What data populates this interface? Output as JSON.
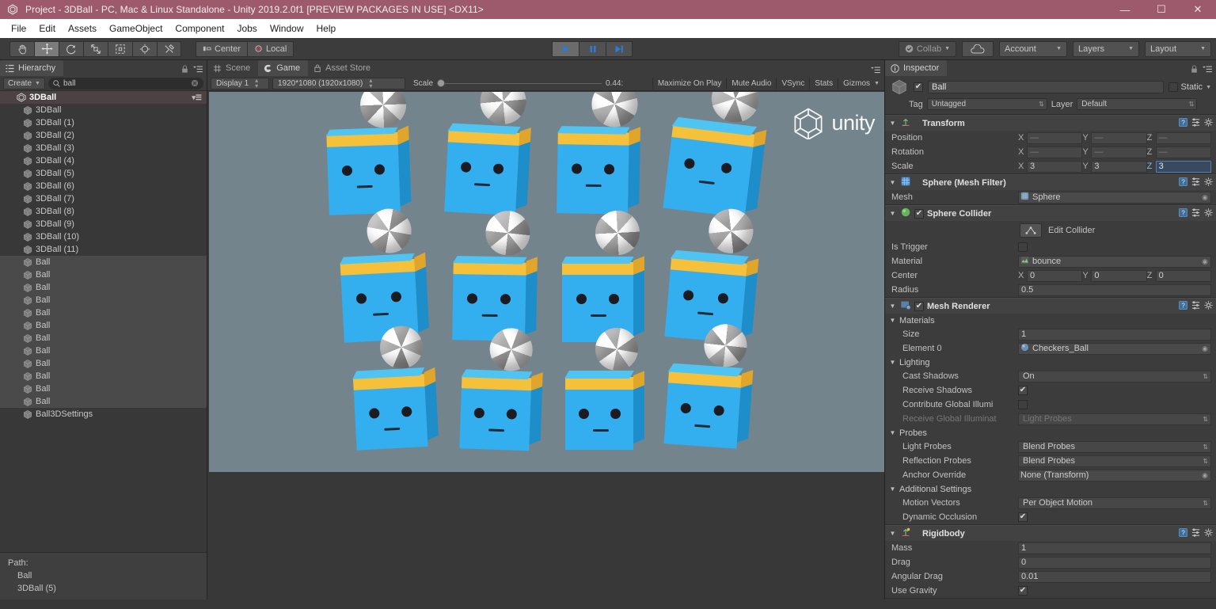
{
  "window": {
    "title": "Project - 3DBall - PC, Mac & Linux Standalone - Unity 2019.2.0f1 [PREVIEW PACKAGES IN USE] <DX11>",
    "minimize": "—",
    "maximize": "☐",
    "close": "✕",
    "titlebar_color": "#9c5a6c"
  },
  "menubar": {
    "items": [
      "File",
      "Edit",
      "Assets",
      "GameObject",
      "Component",
      "Jobs",
      "Window",
      "Help"
    ]
  },
  "toolbar": {
    "tools": [
      {
        "name": "hand-tool",
        "active": false
      },
      {
        "name": "move-tool",
        "active": true
      },
      {
        "name": "rotate-tool",
        "active": false
      },
      {
        "name": "scale-tool",
        "active": false
      },
      {
        "name": "rect-tool",
        "active": false
      },
      {
        "name": "transform-tool",
        "active": false
      },
      {
        "name": "custom-editor-tool",
        "active": false
      }
    ],
    "pivot_mode": "Center",
    "pivot_rotation": "Local",
    "play": "▶",
    "pause": "‖",
    "step": "▶|",
    "play_active": true,
    "collab": "Collab",
    "cloud": "cloud-icon",
    "account": "Account",
    "layers": "Layers",
    "layout": "Layout"
  },
  "hierarchy": {
    "tab": "Hierarchy",
    "create": "Create",
    "search_value": "ball",
    "root": "3DBall",
    "items": [
      {
        "label": "3DBall",
        "selected": false
      },
      {
        "label": "3DBall (1)",
        "selected": false
      },
      {
        "label": "3DBall (2)",
        "selected": false
      },
      {
        "label": "3DBall (3)",
        "selected": false
      },
      {
        "label": "3DBall (4)",
        "selected": false
      },
      {
        "label": "3DBall (5)",
        "selected": false
      },
      {
        "label": "3DBall (6)",
        "selected": false
      },
      {
        "label": "3DBall (7)",
        "selected": false
      },
      {
        "label": "3DBall (8)",
        "selected": false
      },
      {
        "label": "3DBall (9)",
        "selected": false
      },
      {
        "label": "3DBall (10)",
        "selected": false
      },
      {
        "label": "3DBall (11)",
        "selected": false
      },
      {
        "label": "Ball",
        "selected": true
      },
      {
        "label": "Ball",
        "selected": true
      },
      {
        "label": "Ball",
        "selected": true
      },
      {
        "label": "Ball",
        "selected": true
      },
      {
        "label": "Ball",
        "selected": true
      },
      {
        "label": "Ball",
        "selected": true
      },
      {
        "label": "Ball",
        "selected": true
      },
      {
        "label": "Ball",
        "selected": true
      },
      {
        "label": "Ball",
        "selected": true
      },
      {
        "label": "Ball",
        "selected": true
      },
      {
        "label": "Ball",
        "selected": true
      },
      {
        "label": "Ball",
        "selected": true
      },
      {
        "label": "Ball3DSettings",
        "selected": false
      }
    ],
    "path_label": "Path:",
    "path_lines": [
      "Ball",
      "3DBall (5)"
    ]
  },
  "gameview": {
    "tabs": [
      {
        "label": "Scene",
        "active": false,
        "icon": "grid-icon"
      },
      {
        "label": "Game",
        "active": true,
        "icon": "gamepad-icon"
      },
      {
        "label": "Asset Store",
        "active": false,
        "icon": "store-icon"
      }
    ],
    "display": "Display 1",
    "resolution": "1920*1080 (1920x1080)",
    "scale_label": "Scale",
    "scale_value": "0.44:",
    "toggles": [
      "Maximize On Play",
      "Mute Audio",
      "VSync",
      "Stats",
      "Gizmos"
    ],
    "watermark": "unity",
    "background_color": "#74848c",
    "cube_color": "#33aeee",
    "band_color": "#f5c13a",
    "agent_count": 12
  },
  "inspector": {
    "tab": "Inspector",
    "object_name": "Ball",
    "enabled": true,
    "static_label": "Static",
    "static_checked": false,
    "tag_label": "Tag",
    "tag_value": "Untagged",
    "layer_label": "Layer",
    "layer_value": "Default",
    "components": [
      {
        "name": "Transform",
        "icon": "transform-icon",
        "rows": [
          {
            "label": "Position",
            "type": "vec3",
            "x": "—",
            "y": "—",
            "z": "—",
            "dim": true
          },
          {
            "label": "Rotation",
            "type": "vec3",
            "x": "—",
            "y": "—",
            "z": "—",
            "dim": true
          },
          {
            "label": "Scale",
            "type": "vec3",
            "x": "3",
            "y": "3",
            "z": "3",
            "focus_axis": "z"
          }
        ]
      },
      {
        "name": "Sphere (Mesh Filter)",
        "icon": "meshfilter-icon",
        "rows": [
          {
            "label": "Mesh",
            "type": "object",
            "value": "Sphere",
            "icon": "mesh-icon"
          }
        ]
      },
      {
        "name": "Sphere Collider",
        "icon": "collider-icon",
        "checkbox": true,
        "edit_collider_label": "Edit Collider",
        "rows": [
          {
            "label": "Is Trigger",
            "type": "checkbox",
            "checked": false
          },
          {
            "label": "Material",
            "type": "object",
            "value": "bounce",
            "icon": "physicmaterial-icon"
          },
          {
            "label": "Center",
            "type": "vec3",
            "x": "0",
            "y": "0",
            "z": "0"
          },
          {
            "label": "Radius",
            "type": "text",
            "value": "0.5"
          }
        ]
      },
      {
        "name": "Mesh Renderer",
        "icon": "meshrenderer-icon",
        "checkbox": true,
        "groups": [
          {
            "title": "Materials",
            "rows": [
              {
                "label": "Size",
                "type": "text",
                "value": "1",
                "indent": 1
              },
              {
                "label": "Element 0",
                "type": "object",
                "value": "Checkers_Ball",
                "icon": "material-icon",
                "indent": 1
              }
            ]
          },
          {
            "title": "Lighting",
            "rows": [
              {
                "label": "Cast Shadows",
                "type": "dropdown",
                "value": "On",
                "indent": 1
              },
              {
                "label": "Receive Shadows",
                "type": "checkbox",
                "checked": true,
                "indent": 1
              },
              {
                "label": "Contribute Global Illumi",
                "type": "checkbox",
                "checked": false,
                "indent": 1
              },
              {
                "label": "Receive Global Illuminat",
                "type": "dropdown",
                "value": "Light Probes",
                "indent": 1,
                "disabled": true
              }
            ]
          },
          {
            "title": "Probes",
            "rows": [
              {
                "label": "Light Probes",
                "type": "dropdown",
                "value": "Blend Probes",
                "indent": 1
              },
              {
                "label": "Reflection Probes",
                "type": "dropdown",
                "value": "Blend Probes",
                "indent": 1
              },
              {
                "label": "Anchor Override",
                "type": "object",
                "value": "None (Transform)",
                "indent": 1
              }
            ]
          },
          {
            "title": "Additional Settings",
            "rows": [
              {
                "label": "Motion Vectors",
                "type": "dropdown",
                "value": "Per Object Motion",
                "indent": 1
              },
              {
                "label": "Dynamic Occlusion",
                "type": "checkbox",
                "checked": true,
                "indent": 1
              }
            ]
          }
        ]
      },
      {
        "name": "Rigidbody",
        "icon": "rigidbody-icon",
        "rows": [
          {
            "label": "Mass",
            "type": "text",
            "value": "1"
          },
          {
            "label": "Drag",
            "type": "text",
            "value": "0"
          },
          {
            "label": "Angular Drag",
            "type": "text",
            "value": "0.01"
          },
          {
            "label": "Use Gravity",
            "type": "checkbox",
            "checked": true
          }
        ]
      }
    ]
  }
}
